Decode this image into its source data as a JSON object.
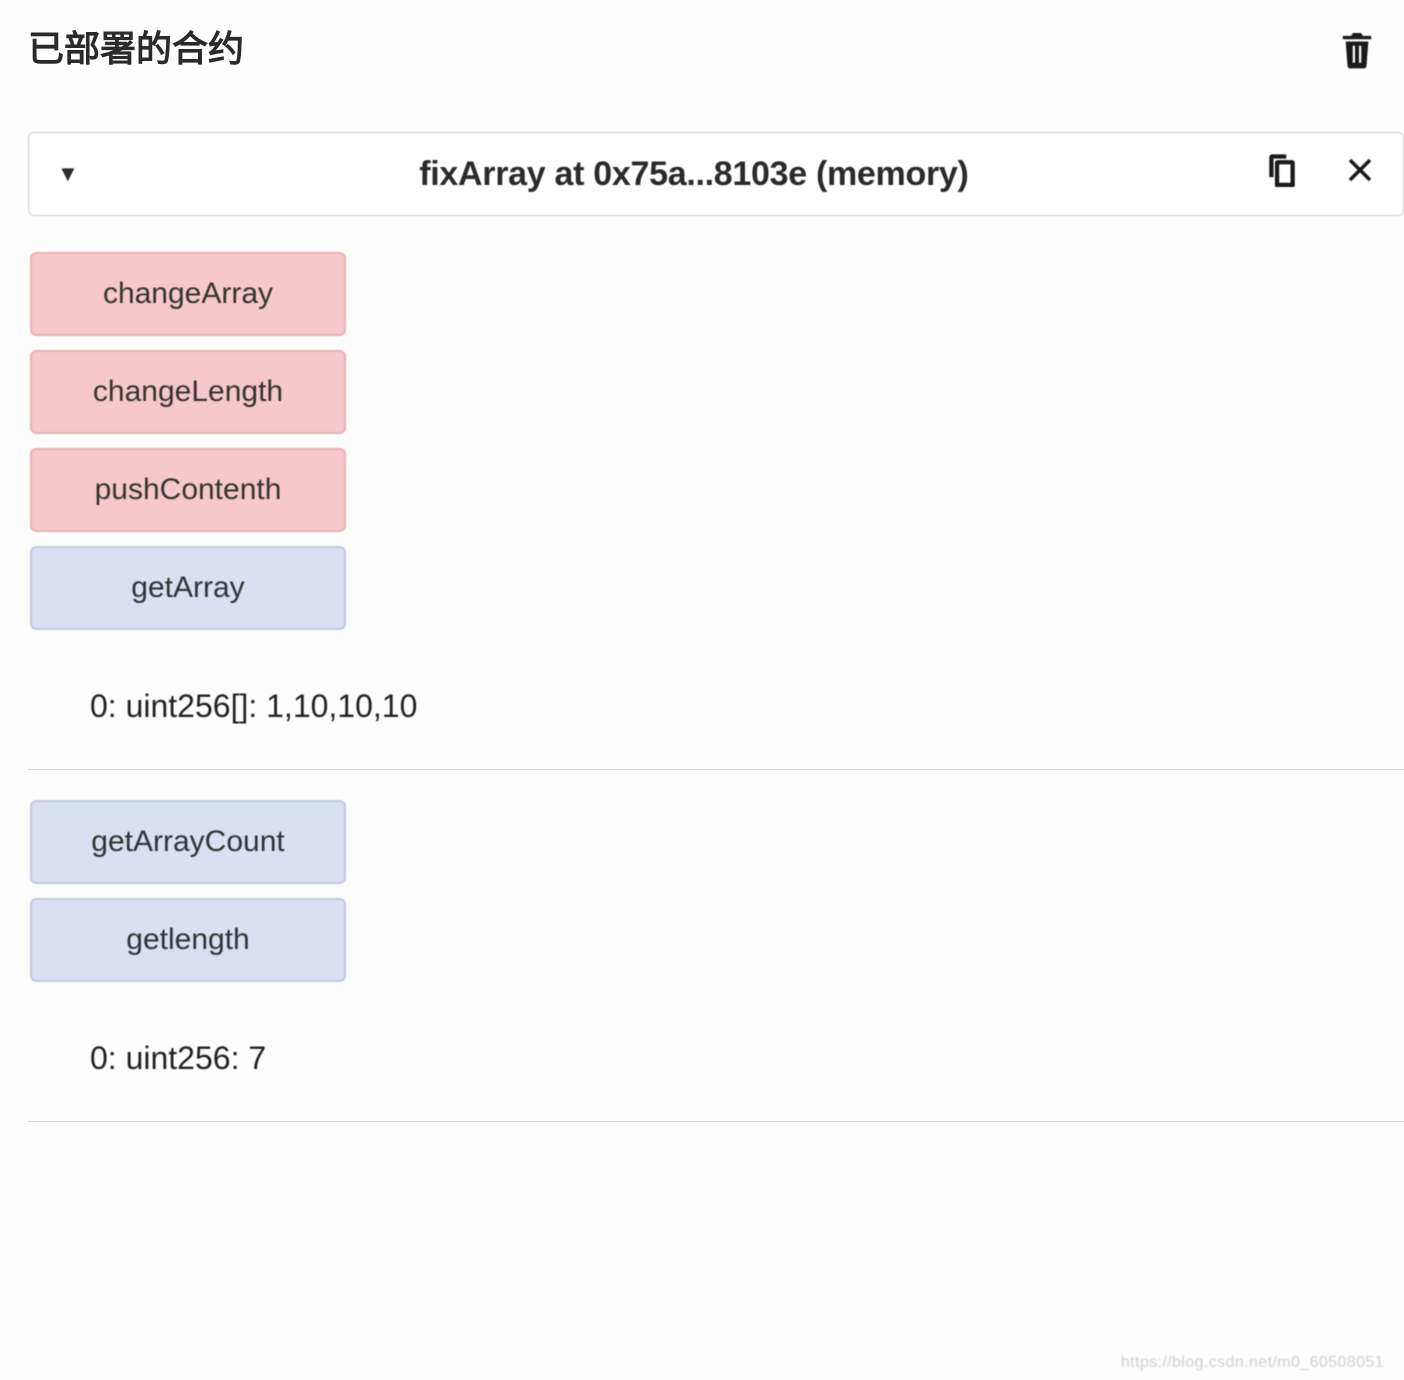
{
  "section_title": "已部署的合约",
  "trash_icon": "trash-icon",
  "contract": {
    "toggle": "▼",
    "title": "fixArray at 0x75a...8103e (memory)",
    "copy_label": "copy",
    "close_label": "✖"
  },
  "functions": [
    {
      "label": "changeArray",
      "style": "red"
    },
    {
      "label": "changeLength",
      "style": "red"
    },
    {
      "label": "pushContenth",
      "style": "red"
    },
    {
      "label": "getArray",
      "style": "blue"
    }
  ],
  "result1": "0: uint256[]: 1,10,10,10",
  "functions2": [
    {
      "label": "getArrayCount",
      "style": "blue"
    },
    {
      "label": "getlength",
      "style": "blue"
    }
  ],
  "result2": "0: uint256: 7",
  "watermark": "https://blog.csdn.net/m0_60508051"
}
